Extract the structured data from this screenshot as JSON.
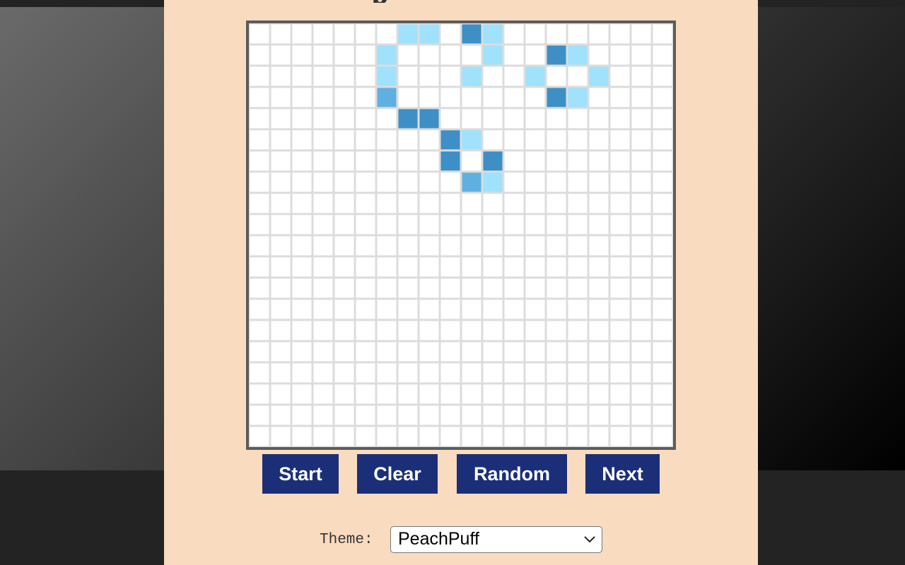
{
  "board": {
    "rows": 20,
    "cols": 20,
    "colors": {
      "empty": "#ffffff",
      "grid": "#dcdcdc",
      "frame": "#5c5c5c",
      "young": "#a0e1fb",
      "mid": "#5fb0e0",
      "old": "#3d8fc6"
    },
    "cells": [
      [
        0,
        7,
        "young"
      ],
      [
        0,
        8,
        "young"
      ],
      [
        0,
        10,
        "old"
      ],
      [
        0,
        11,
        "young"
      ],
      [
        1,
        6,
        "young"
      ],
      [
        1,
        11,
        "young"
      ],
      [
        1,
        14,
        "old"
      ],
      [
        1,
        15,
        "young"
      ],
      [
        2,
        6,
        "young"
      ],
      [
        2,
        10,
        "young"
      ],
      [
        2,
        13,
        "young"
      ],
      [
        2,
        16,
        "young"
      ],
      [
        3,
        6,
        "mid"
      ],
      [
        3,
        14,
        "old"
      ],
      [
        3,
        15,
        "young"
      ],
      [
        4,
        7,
        "old"
      ],
      [
        4,
        8,
        "old"
      ],
      [
        5,
        9,
        "old"
      ],
      [
        5,
        10,
        "young"
      ],
      [
        6,
        9,
        "old"
      ],
      [
        6,
        11,
        "old"
      ],
      [
        7,
        10,
        "mid"
      ],
      [
        7,
        11,
        "young"
      ]
    ]
  },
  "controls": {
    "start_label": "Start",
    "clear_label": "Clear",
    "random_label": "Random",
    "next_label": "Next"
  },
  "theme": {
    "label": "Theme:",
    "selected": "PeachPuff"
  }
}
